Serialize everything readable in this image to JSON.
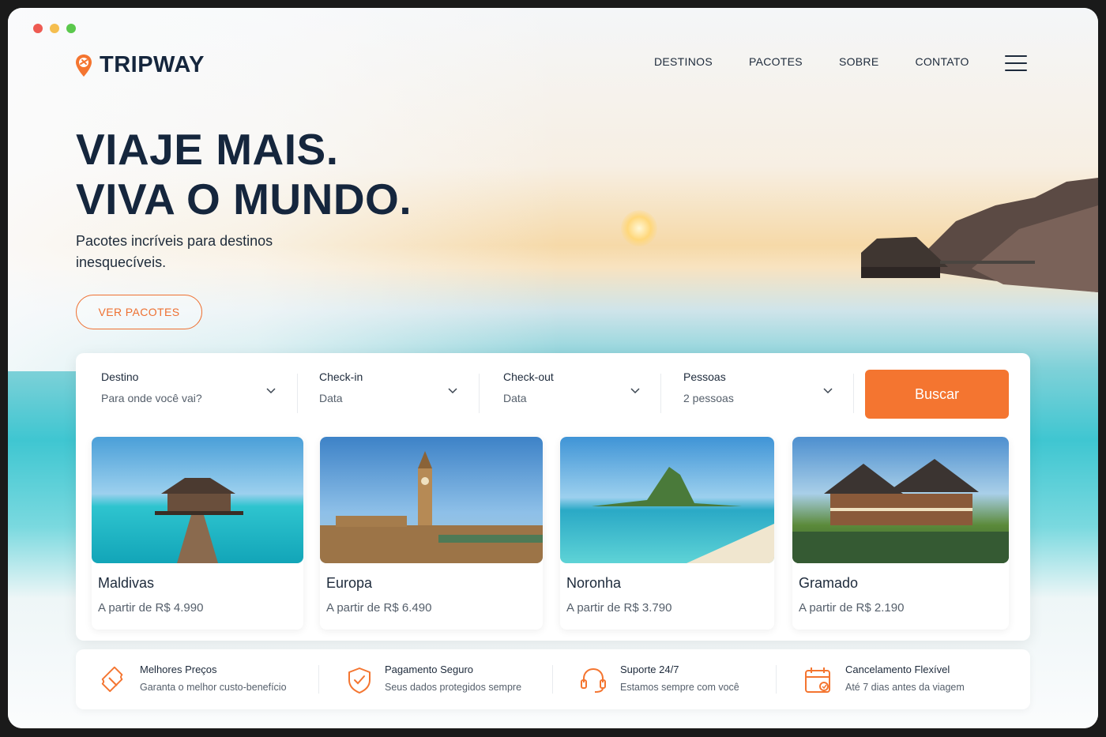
{
  "window": {
    "controls": [
      "close",
      "minimize",
      "maximize"
    ],
    "colors": {
      "close": "#ee5a52",
      "minimize": "#f5be4f",
      "maximize": "#5bc84c"
    }
  },
  "brand": {
    "name": "TRIPWAY",
    "logo_icon": "map-pin-plane-icon",
    "accent": "#f47530",
    "text_color": "#15263d"
  },
  "nav": {
    "items": [
      "DESTINOS",
      "PACOTES",
      "SOBRE",
      "CONTATO"
    ],
    "menu_icon": "hamburger-icon"
  },
  "hero": {
    "headline_line1": "VIAJE MAIS.",
    "headline_line2": "VIVA O MUNDO.",
    "subtitle": "Pacotes incríveis para destinos inesquecíveis.",
    "cta_label": "VER PACOTES"
  },
  "search": {
    "fields": [
      {
        "label": "Destino",
        "value": "Para onde você vai?"
      },
      {
        "label": "Check-in",
        "value": "Data"
      },
      {
        "label": "Check-out",
        "value": "Data"
      },
      {
        "label": "Pessoas",
        "value": "2 pessoas"
      }
    ],
    "submit_label": "Buscar"
  },
  "destinations": [
    {
      "name": "Maldivas",
      "price": "A partir de R$ 4.990"
    },
    {
      "name": "Europa",
      "price": "A partir de R$ 6.490"
    },
    {
      "name": "Noronha",
      "price": "A partir de R$ 3.790"
    },
    {
      "name": "Gramado",
      "price": "A partir de R$ 2.190"
    }
  ],
  "features": [
    {
      "title": "Melhores Preços",
      "subtitle": "Garanta o melhor custo-benefício",
      "icon": "ticket-icon"
    },
    {
      "title": "Pagamento Seguro",
      "subtitle": "Seus dados protegidos sempre",
      "icon": "shield-check-icon"
    },
    {
      "title": "Suporte 24/7",
      "subtitle": "Estamos sempre com você",
      "icon": "headset-icon"
    },
    {
      "title": "Cancelamento Flexível",
      "subtitle": "Até 7 dias antes da viagem",
      "icon": "calendar-icon"
    }
  ]
}
